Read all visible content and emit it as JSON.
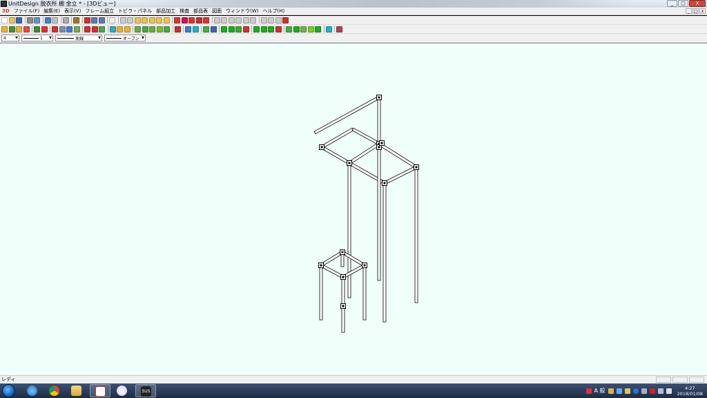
{
  "window": {
    "title": "UnitDesign 脱衣所  棚  金立 * - [3Dビュー]",
    "minimize": "_",
    "maximize": "□",
    "close": "X"
  },
  "menubar": {
    "doc_icon": "3D",
    "items": [
      "ファイル(F)",
      "編集(E)",
      "表示(V)",
      "フレーム組立",
      "トビラ・パネル",
      "部品加工",
      "検査",
      "部品表",
      "図面",
      "ウィンドウ(W)",
      "ヘルプ(H)"
    ],
    "mdi_buttons": [
      "_",
      "□",
      "x"
    ]
  },
  "toolbar3": {
    "scale_value": "4",
    "line_width_value": "1",
    "line_type_value": "実線",
    "arrow_type_value": "オープン"
  },
  "statusbar": {
    "text": "レディ"
  },
  "taskbar": {
    "apps": [
      "internet-explorer-icon",
      "chrome-icon",
      "file-explorer-icon",
      "unitdesign-icon",
      "itunes-icon",
      "sus-icon"
    ],
    "sus_label": "SUS",
    "ime_label": "A 般",
    "clock_time": "4:27",
    "clock_date": "2018/01/08"
  },
  "colors": {
    "viewport_bg": "#f0fffa",
    "frame_stroke": "#000000"
  }
}
